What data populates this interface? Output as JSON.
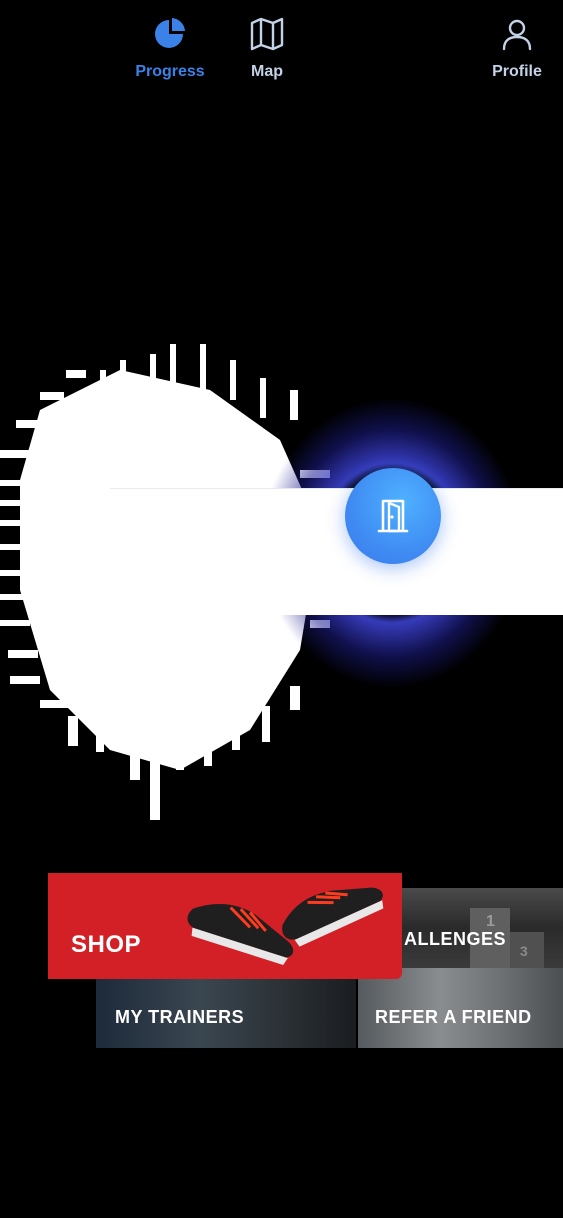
{
  "tabbar": {
    "items": [
      {
        "label": "Progress",
        "icon": "pie-chart-icon",
        "active": true
      },
      {
        "label": "Map",
        "icon": "map-icon",
        "active": false
      },
      {
        "label": "Profile",
        "icon": "user-icon",
        "active": false
      }
    ],
    "center_button": {
      "icon": "door-icon"
    }
  },
  "tiles": {
    "shop": "SHOP",
    "challenges": "ALLENGES",
    "trainers": "MY TRAINERS",
    "refer": "REFER A FRIEND"
  },
  "colors": {
    "accent": "#3b82e8",
    "inactive": "#c4d2e6",
    "shop_red": "#d32027"
  }
}
